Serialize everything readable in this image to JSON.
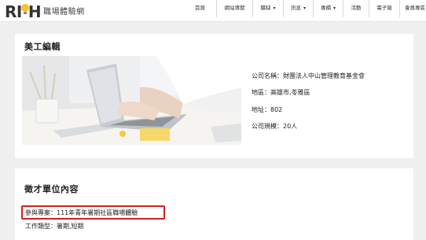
{
  "header": {
    "logo_text": "RICH",
    "logo_sub": "職場體驗網",
    "nav": [
      {
        "label": "首頁",
        "dropdown": false
      },
      {
        "label": "網站導覽",
        "dropdown": false
      },
      {
        "label": "職缺",
        "dropdown": true
      },
      {
        "label": "訊息",
        "dropdown": true
      },
      {
        "label": "專欄",
        "dropdown": true
      },
      {
        "label": "活動",
        "dropdown": false
      },
      {
        "label": "電子報",
        "dropdown": false
      },
      {
        "label": "會員專區",
        "dropdown": true
      }
    ]
  },
  "job": {
    "title": "美工編輯",
    "company_name": "公司名稱：財團法人中山管理教育基金會",
    "area": "地區：高雄市,苓雅區",
    "address": "地址：802",
    "size": "公司規模：20人"
  },
  "recruit": {
    "section_title": "徵才單位內容",
    "project": "參與專案：111年青年暑期社區職場體驗",
    "job_type": "工作類型：暑期,短期"
  },
  "colors": {
    "accent": "#f2c12e",
    "highlight_border": "#d61f1f",
    "page_bg": "#f0f0f0"
  }
}
